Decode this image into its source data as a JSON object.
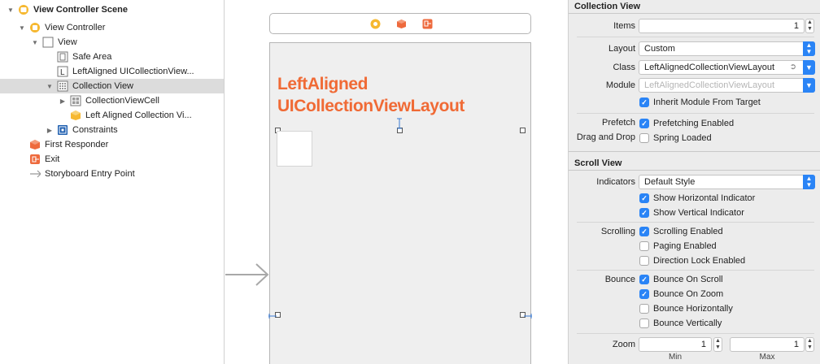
{
  "outline": {
    "items": [
      {
        "label": "View Controller Scene",
        "bold": true,
        "icon": "scene-icon"
      },
      {
        "label": "View Controller",
        "icon": "view-controller-icon"
      },
      {
        "label": "View",
        "icon": "view-icon"
      },
      {
        "label": "Safe Area",
        "icon": "safe-area-icon"
      },
      {
        "label": "LeftAligned UICollectionView...",
        "icon": "label-icon"
      },
      {
        "label": "Collection View",
        "icon": "collection-view-icon"
      },
      {
        "label": "CollectionViewCell",
        "icon": "collection-view-cell-icon"
      },
      {
        "label": "Left Aligned Collection Vi...",
        "icon": "object-icon"
      },
      {
        "label": "Constraints",
        "icon": "constraints-icon"
      },
      {
        "label": "First Responder",
        "icon": "first-responder-icon"
      },
      {
        "label": "Exit",
        "icon": "exit-icon"
      },
      {
        "label": "Storyboard Entry Point",
        "icon": "entry-point-icon"
      }
    ]
  },
  "canvas": {
    "title_line1": "LeftAligned",
    "title_line2": "UICollectionViewLayout"
  },
  "inspector": {
    "collection_view": {
      "title": "Collection View",
      "items_label": "Items",
      "items_value": "1",
      "layout_label": "Layout",
      "layout_value": "Custom",
      "class_label": "Class",
      "class_value": "LeftAlignedCollectionViewLayout",
      "module_label": "Module",
      "module_placeholder": "LeftAlignedCollectionViewLayout",
      "inherit_module": "Inherit Module From Target",
      "prefetch_label": "Prefetch",
      "prefetching_enabled": "Prefetching Enabled",
      "drag_drop_label": "Drag and Drop",
      "spring_loaded": "Spring Loaded"
    },
    "scroll_view": {
      "title": "Scroll View",
      "indicators_label": "Indicators",
      "indicators_value": "Default Style",
      "show_horizontal": "Show Horizontal Indicator",
      "show_vertical": "Show Vertical Indicator",
      "scrolling_label": "Scrolling",
      "scrolling_enabled": "Scrolling Enabled",
      "paging_enabled": "Paging Enabled",
      "direction_lock": "Direction Lock Enabled",
      "bounce_label": "Bounce",
      "bounce_on_scroll": "Bounce On Scroll",
      "bounce_on_zoom": "Bounce On Zoom",
      "bounce_horizontally": "Bounce Horizontally",
      "bounce_vertically": "Bounce Vertically",
      "zoom_label": "Zoom",
      "zoom_min": "1",
      "zoom_max": "1",
      "min_caption": "Min",
      "max_caption": "Max"
    }
  },
  "colors": {
    "accent": "#2a84f6",
    "title_orange": "#f06a35",
    "selection": "#dcdcdc"
  }
}
